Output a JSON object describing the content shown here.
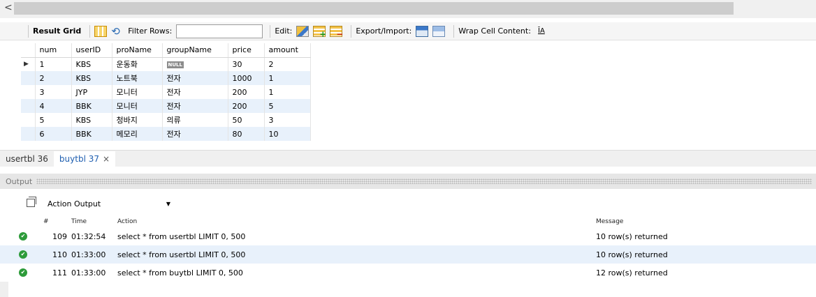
{
  "scroll": {
    "left_arrow": "<"
  },
  "toolbar": {
    "result_grid": "Result Grid",
    "filter_rows": "Filter Rows:",
    "filter_value": "",
    "edit": "Edit:",
    "export_import": "Export/Import:",
    "wrap": "Wrap Cell Content:",
    "wrap_icon": "ĪA"
  },
  "grid": {
    "columns": [
      "num",
      "userID",
      "proName",
      "groupName",
      "price",
      "amount"
    ],
    "rows": [
      {
        "num": "1",
        "userID": "KBS",
        "proName": "운동화",
        "groupName": "NULL",
        "price": "30",
        "amount": "2"
      },
      {
        "num": "2",
        "userID": "KBS",
        "proName": "노트북",
        "groupName": "전자",
        "price": "1000",
        "amount": "1"
      },
      {
        "num": "3",
        "userID": "JYP",
        "proName": "모니터",
        "groupName": "전자",
        "price": "200",
        "amount": "1"
      },
      {
        "num": "4",
        "userID": "BBK",
        "proName": "모니터",
        "groupName": "전자",
        "price": "200",
        "amount": "5"
      },
      {
        "num": "5",
        "userID": "KBS",
        "proName": "청바지",
        "groupName": "의류",
        "price": "50",
        "amount": "3"
      },
      {
        "num": "6",
        "userID": "BBK",
        "proName": "메모리",
        "groupName": "전자",
        "price": "80",
        "amount": "10"
      }
    ],
    "row_pointer": "▶"
  },
  "tabs": [
    {
      "label": "usertbl 36",
      "active": false
    },
    {
      "label": "buytbl 37",
      "active": true,
      "close": "×"
    }
  ],
  "output": {
    "title": "Output",
    "selector": "Action Output",
    "headers": {
      "num": "#",
      "time": "Time",
      "action": "Action",
      "message": "Message"
    },
    "rows": [
      {
        "num": "109",
        "time": "01:32:54",
        "action": "select * from usertbl LIMIT 0, 500",
        "message": "10 row(s) returned"
      },
      {
        "num": "110",
        "time": "01:33:00",
        "action": "select * from usertbl LIMIT 0, 500",
        "message": "10 row(s) returned"
      },
      {
        "num": "111",
        "time": "01:33:00",
        "action": "select * from buytbl LIMIT 0, 500",
        "message": "12 row(s) returned"
      }
    ]
  },
  "colors": {
    "alt_row": "#e8f1fb",
    "active_tab": "#1f5fb0",
    "success": "#2d9b3a"
  }
}
